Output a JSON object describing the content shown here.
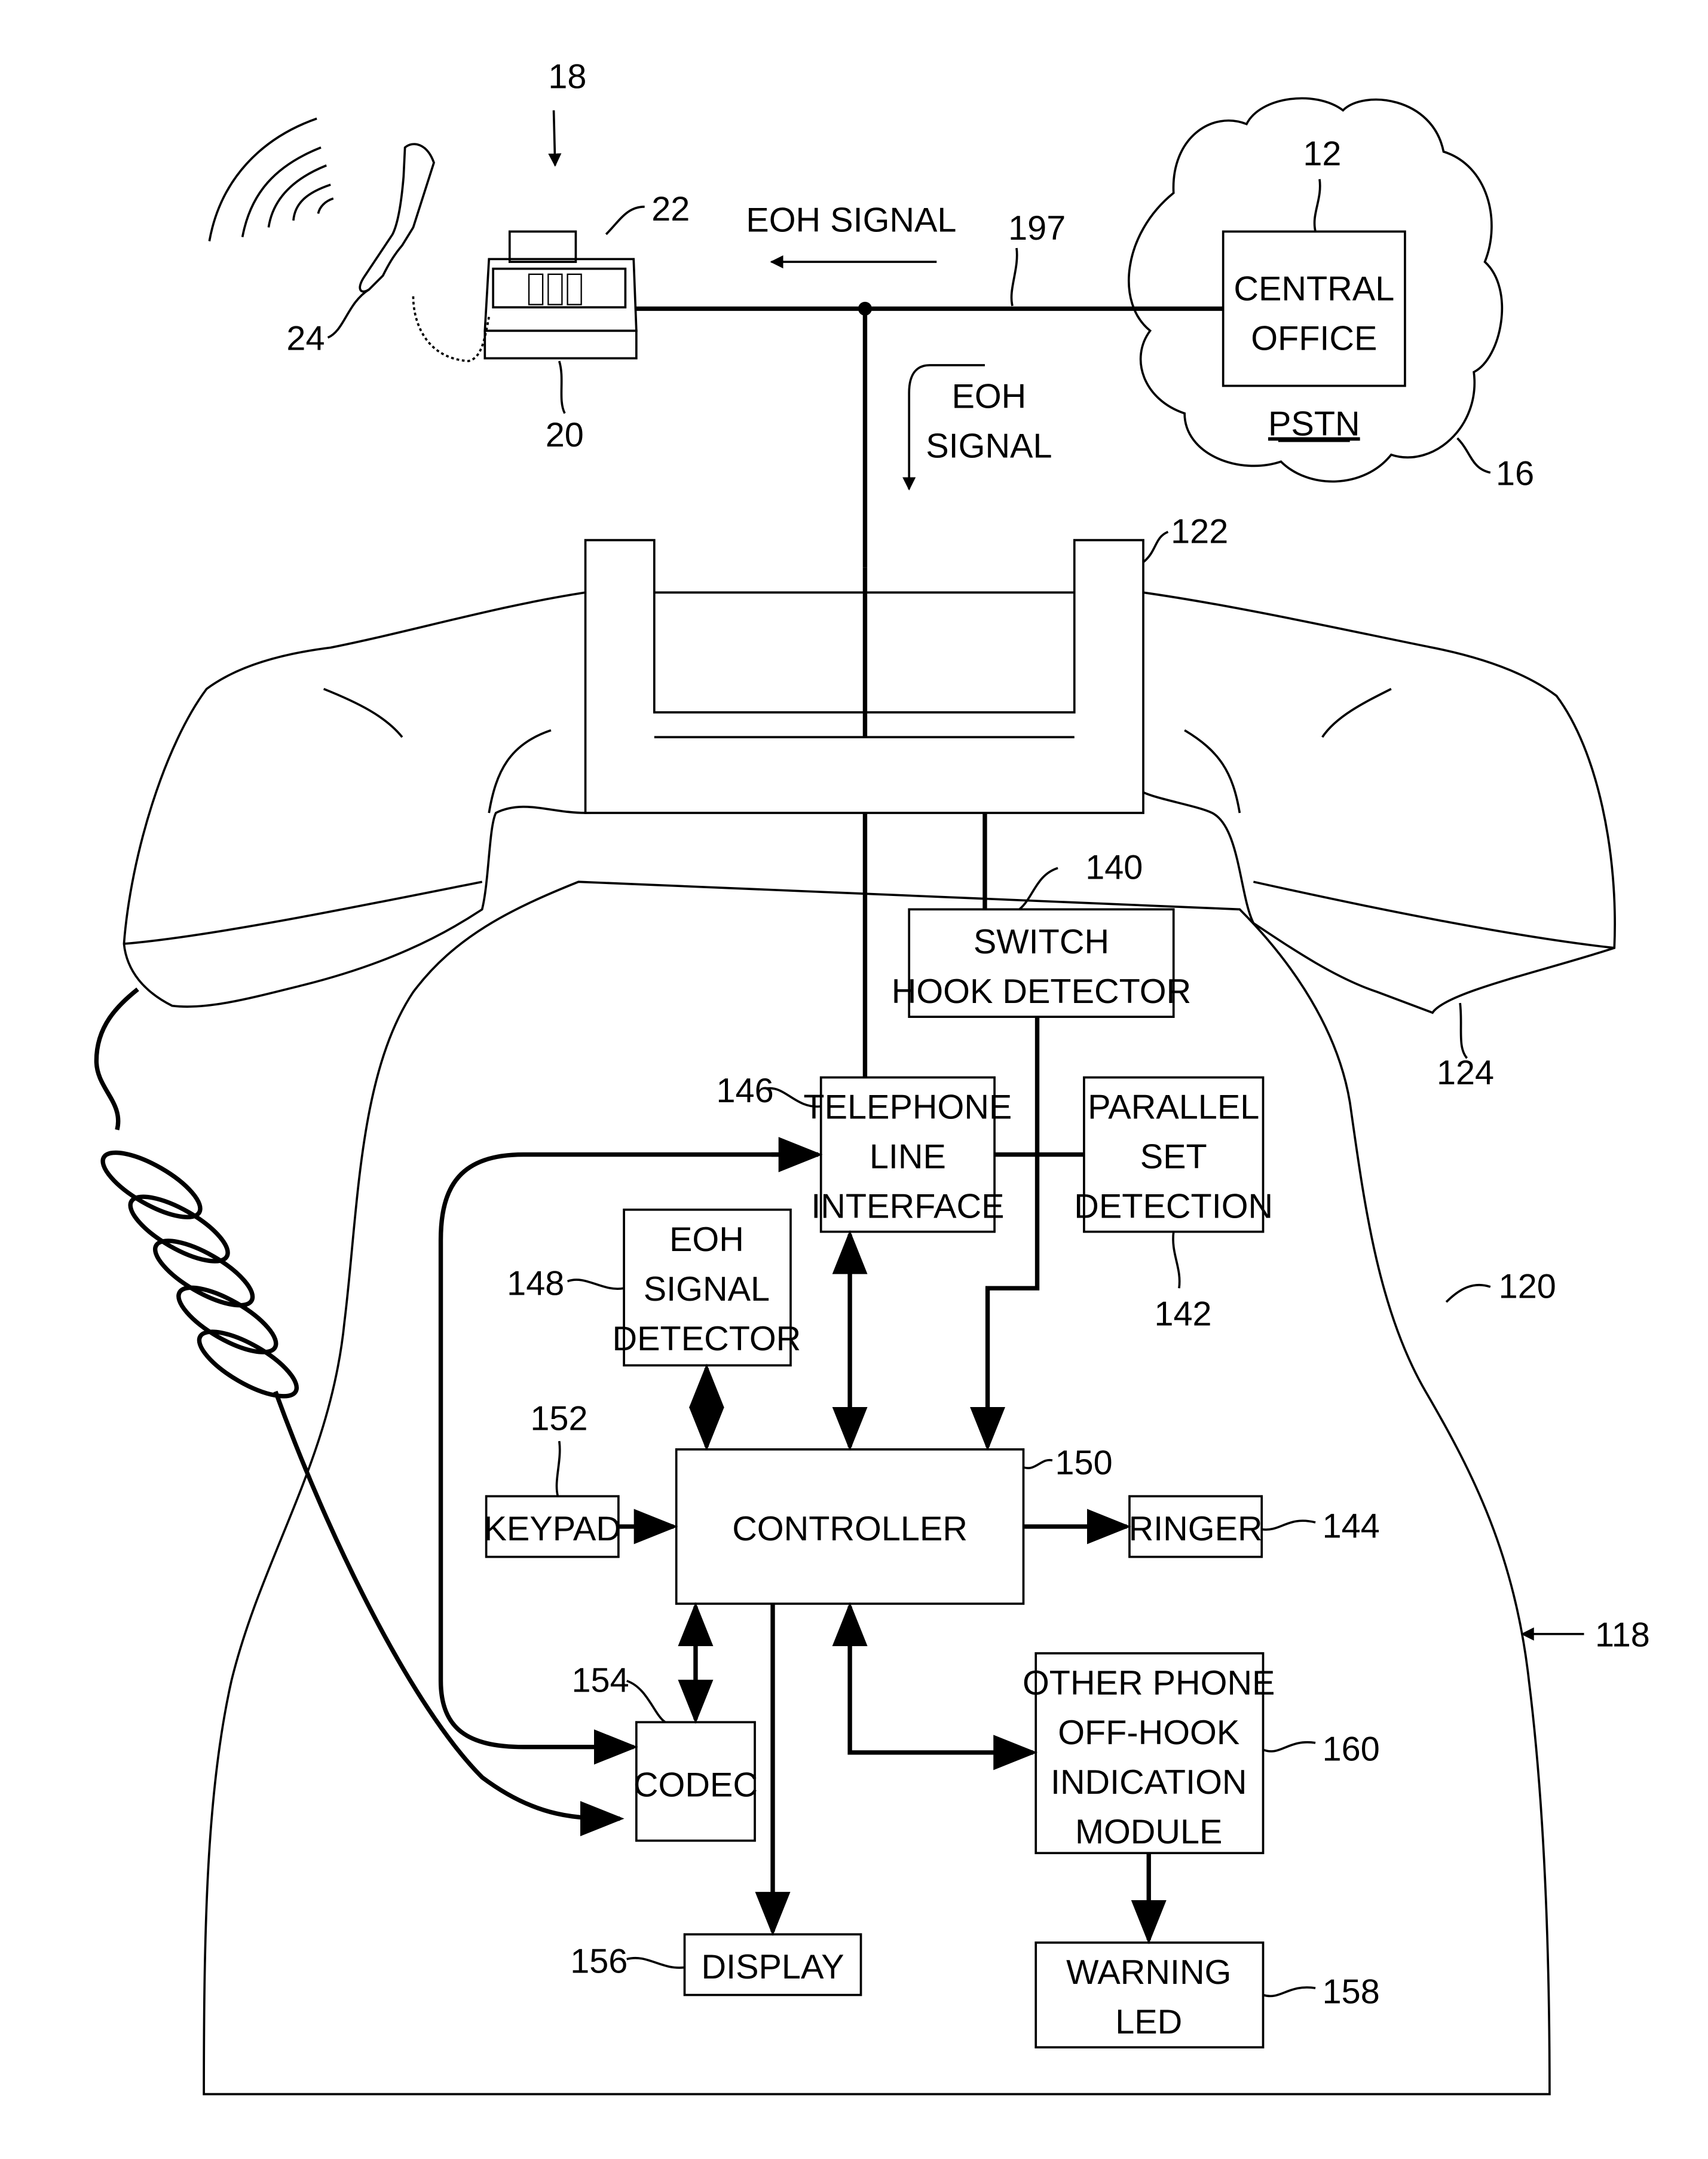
{
  "figure": {
    "phone_ref": "18",
    "phone_base_ref": "20",
    "phone_cradle_ref": "22",
    "handset_ref": "24",
    "line_ref": "197",
    "central_office": {
      "ref": "12",
      "lines": [
        "CENTRAL",
        "OFFICE"
      ]
    },
    "pstn": {
      "ref": "16",
      "label": "PSTN"
    },
    "eoh_signal_horizontal": "EOH SIGNAL",
    "eoh_signal_vertical": [
      "EOH",
      "SIGNAL"
    ],
    "cradle_ref": "122",
    "handset_large_ref": "124",
    "body_ref": "120",
    "device_ref": "118",
    "blocks": {
      "switch_hook_detector": {
        "ref": "140",
        "lines": [
          "SWITCH",
          "HOOK DETECTOR"
        ]
      },
      "parallel_set_detection": {
        "ref": "142",
        "lines": [
          "PARALLEL",
          "SET",
          "DETECTION"
        ]
      },
      "telephone_line_interface": {
        "ref": "146",
        "lines": [
          "TELEPHONE",
          "LINE",
          "INTERFACE"
        ]
      },
      "eoh_signal_detector": {
        "ref": "148",
        "lines": [
          "EOH",
          "SIGNAL",
          "DETECTOR"
        ]
      },
      "keypad": {
        "ref": "152",
        "lines": [
          "KEYPAD"
        ]
      },
      "controller": {
        "ref": "150",
        "lines": [
          "CONTROLLER"
        ]
      },
      "ringer": {
        "ref": "144",
        "lines": [
          "RINGER"
        ]
      },
      "codec": {
        "ref": "154",
        "lines": [
          "CODEC"
        ]
      },
      "display": {
        "ref": "156",
        "lines": [
          "DISPLAY"
        ]
      },
      "other_phone_module": {
        "ref": "160",
        "lines": [
          "OTHER PHONE",
          "OFF-HOOK",
          "INDICATION",
          "MODULE"
        ]
      },
      "warning_led": {
        "ref": "158",
        "lines": [
          "WARNING",
          "LED"
        ]
      }
    }
  }
}
